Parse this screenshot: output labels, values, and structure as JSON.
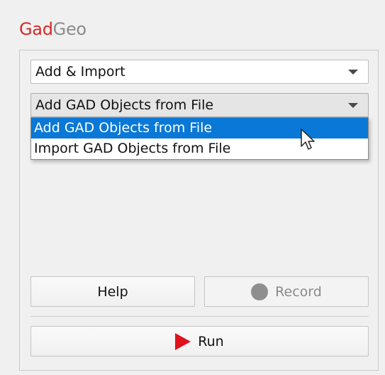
{
  "app": {
    "title_part1": "Gad",
    "title_part2": "Geo",
    "brand_color": "#d62828",
    "brand_secondary_color": "#8c8c8c"
  },
  "category_combo": {
    "value": "Add & Import",
    "icon": "chevron-down-icon"
  },
  "action_combo": {
    "value": "Add GAD Objects from File",
    "icon": "chevron-down-icon",
    "state": "open",
    "options": [
      {
        "label": "Add GAD Objects from File",
        "selected": true
      },
      {
        "label": "Import GAD Objects from File",
        "selected": false
      }
    ],
    "selection_color": "#0a78d7"
  },
  "buttons": {
    "help_label": "Help",
    "record_label": "Record",
    "record_icon": "record-dot-icon",
    "record_enabled": false,
    "run_label": "Run",
    "run_icon": "play-icon",
    "run_icon_color": "#e0121b"
  },
  "cursor": {
    "icon": "mouse-pointer-icon"
  }
}
